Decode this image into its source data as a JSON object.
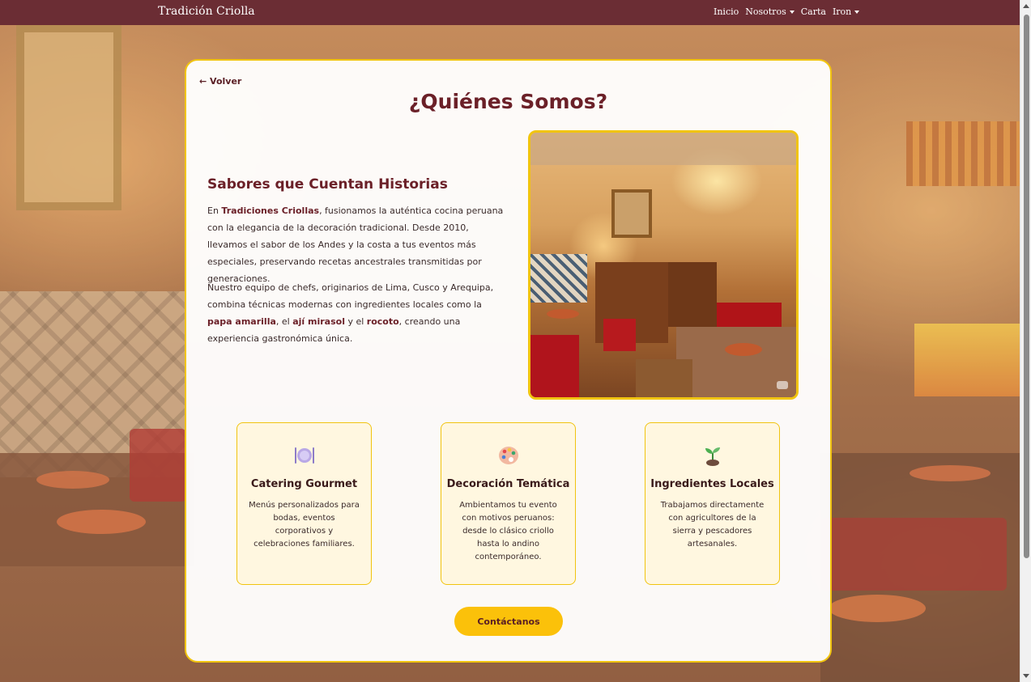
{
  "navbar": {
    "brand": "Tradición Criolla",
    "links": [
      {
        "label": "Inicio"
      },
      {
        "label": "Nosotros"
      },
      {
        "label": "Carta"
      },
      {
        "label": "Iron"
      }
    ]
  },
  "about": {
    "back_label": "← Volver",
    "title": "¿Quiénes Somos?",
    "heading": "Sabores que Cuentan Historias",
    "p1": {
      "t1": "En ",
      "b1": "Tradiciones Criollas",
      "t2": ", fusionamos la auténtica cocina peruana con la elegancia de la decoración tradicional. Desde 2010, llevamos el sabor de los Andes y la costa a tus eventos más especiales, preservando recetas ancestrales transmitidas por generaciones."
    },
    "p2": {
      "t1": "Nuestro equipo de chefs, originarios de Lima, Cusco y Arequipa, combina técnicas modernas con ingredientes locales como la ",
      "b1": "papa amarilla",
      "t2": ", el ",
      "b2": "ají mirasol",
      "t3": " y el ",
      "b3": "rocoto",
      "t4": ", creando una experiencia gastronómica única."
    },
    "features": [
      {
        "icon": "plate-cutlery-icon",
        "title": "Catering Gourmet",
        "desc": "Menús personalizados para bodas, eventos corporativos y celebraciones familiares."
      },
      {
        "icon": "palette-icon",
        "title": "Decoración Temática",
        "desc": "Ambientamos tu evento con motivos peruanos: desde lo clásico criollo hasta lo andino contemporáneo."
      },
      {
        "icon": "seedling-icon",
        "title": "Ingredientes Locales",
        "desc": "Trabajamos directamente con agricultores de la sierra y pescadores artesanales."
      }
    ],
    "cta_label": "Contáctanos"
  },
  "colors": {
    "navbar": "#6b2d34",
    "accent": "#f1c40f",
    "button": "#fbc10a",
    "title": "#6b2028"
  }
}
